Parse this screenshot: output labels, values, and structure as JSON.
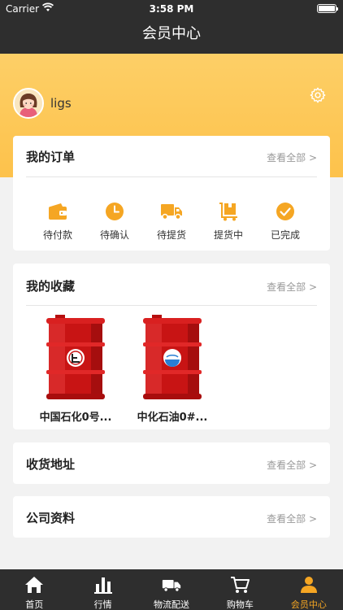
{
  "status_bar": {
    "carrier": "Carrier",
    "time": "3:58 PM"
  },
  "header": {
    "title": "会员中心"
  },
  "profile": {
    "username": "ligs"
  },
  "orders": {
    "title": "我的订单",
    "view_all": "查看全部 >",
    "items": [
      {
        "label": "待付款",
        "icon": "wallet-icon"
      },
      {
        "label": "待确认",
        "icon": "clock-icon"
      },
      {
        "label": "待提货",
        "icon": "truck-icon"
      },
      {
        "label": "提货中",
        "icon": "cart-box-icon"
      },
      {
        "label": "已完成",
        "icon": "check-circle-icon"
      }
    ]
  },
  "favorites": {
    "title": "我的收藏",
    "view_all": "查看全部 >",
    "items": [
      {
        "name": "中国石化0号...",
        "logo": "sinopec-logo"
      },
      {
        "name": "中化石油0#...",
        "logo": "sinochem-logo"
      }
    ]
  },
  "address": {
    "title": "收货地址",
    "view_all": "查看全部 >"
  },
  "company": {
    "title": "公司资料",
    "view_all": "查看全部 >"
  },
  "tabs": [
    {
      "label": "首页",
      "icon": "home-icon"
    },
    {
      "label": "行情",
      "icon": "bar-chart-icon"
    },
    {
      "label": "物流配送",
      "icon": "truck-icon"
    },
    {
      "label": "购物车",
      "icon": "cart-icon"
    },
    {
      "label": "会员中心",
      "icon": "user-icon",
      "active": true
    }
  ],
  "colors": {
    "accent": "#f5a623",
    "header_bg": "#2e2e2e",
    "profile_bg": "#fdc24b"
  }
}
